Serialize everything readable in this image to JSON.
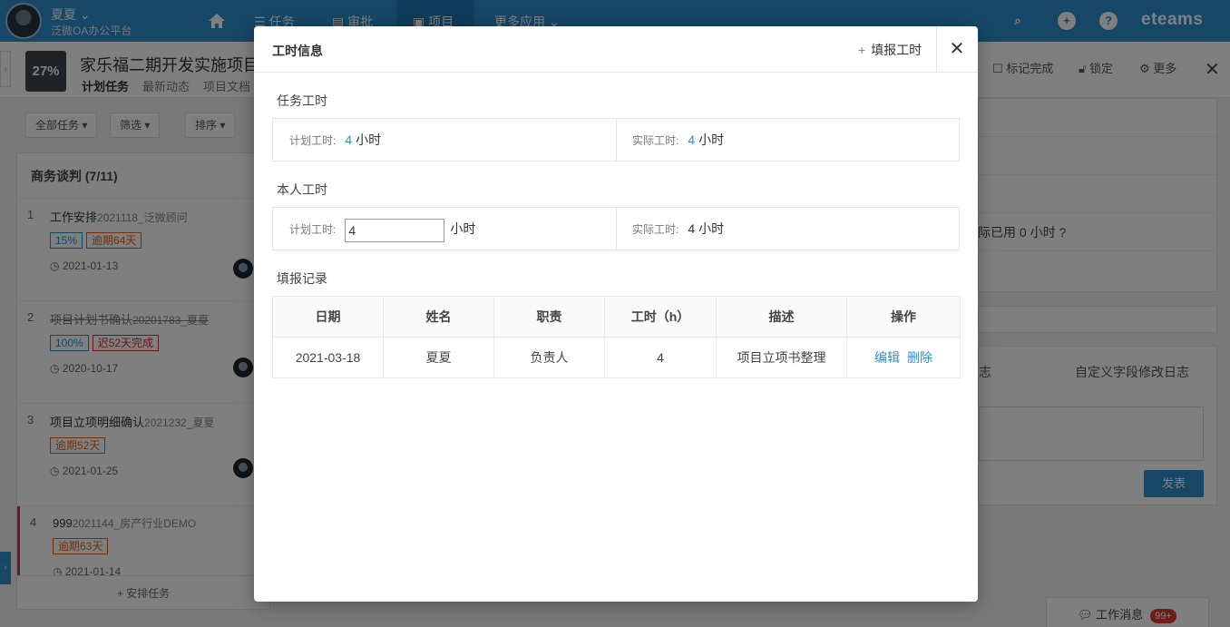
{
  "topbar": {
    "user_name": "夏夏 ⌄",
    "org": "泛微OA办公平台",
    "nav": [
      "任务",
      "审批",
      "项目",
      "更多应用 ⌄"
    ],
    "brand": "eteams"
  },
  "project": {
    "progress": "27%",
    "title": "家乐福二期开发实施项目",
    "tabs": [
      "计划任务",
      "最新动态",
      "项目文档"
    ],
    "actions": [
      "标记完成",
      "锁定",
      "更多"
    ]
  },
  "list": {
    "toolbar": [
      "全部任务 ▾",
      "筛选 ▾",
      "排序 ▾"
    ],
    "group_title": "商务谈判 (7/11)",
    "tasks": [
      {
        "no": "1",
        "name": "工作安排",
        "sub": "2021118_泛微顾问",
        "tags": [
          "15%",
          "逾期64天"
        ],
        "date": "2021-01-13"
      },
      {
        "no": "2",
        "name": "项目计划书确认",
        "sub": "20201783_夏夏",
        "tags": [
          "100%",
          "迟52天完成"
        ],
        "date": "2020-10-17"
      },
      {
        "no": "3",
        "name": "项目立项明细确认",
        "sub": "2021232_夏夏",
        "tags": [
          "逾期52天"
        ],
        "date": "2021-01-25"
      },
      {
        "no": "4",
        "name": "999",
        "sub": "2021144_房产行业DEMO",
        "tags": [
          "逾期63天"
        ],
        "date": "2021-01-14"
      }
    ],
    "add_task": "+ 安排任务"
  },
  "right": {
    "actual_text": "际已用 0 小时",
    "tab_a": "志",
    "tab_b": "自定义字段修改日志",
    "send": "发表",
    "msg_label": "工作消息",
    "msg_badge": "99+"
  },
  "modal": {
    "title": "工时信息",
    "add_label": "填报工时",
    "task_hours_title": "任务工时",
    "task_hours": {
      "plan_label": "计划工时:",
      "plan_value": "4",
      "actual_label": "实际工时:",
      "actual_value": "4",
      "unit": "小时"
    },
    "my_hours_title": "本人工时",
    "my_hours": {
      "plan_label": "计划工时:",
      "plan_input": "4",
      "actual_label": "实际工时:",
      "actual_value": "4",
      "unit": "小时"
    },
    "records_title": "填报记录",
    "columns": [
      "日期",
      "姓名",
      "职责",
      "工时（h）",
      "描述",
      "操作"
    ],
    "rows": [
      {
        "date": "2021-03-18",
        "name": "夏夏",
        "role": "负责人",
        "hours": "4",
        "desc": "项目立项书整理",
        "edit": "编辑",
        "delete": "删除"
      }
    ]
  },
  "colors": {
    "primary": "#2d8fcf",
    "danger": "#e53935",
    "overdue": "#e2621e"
  }
}
